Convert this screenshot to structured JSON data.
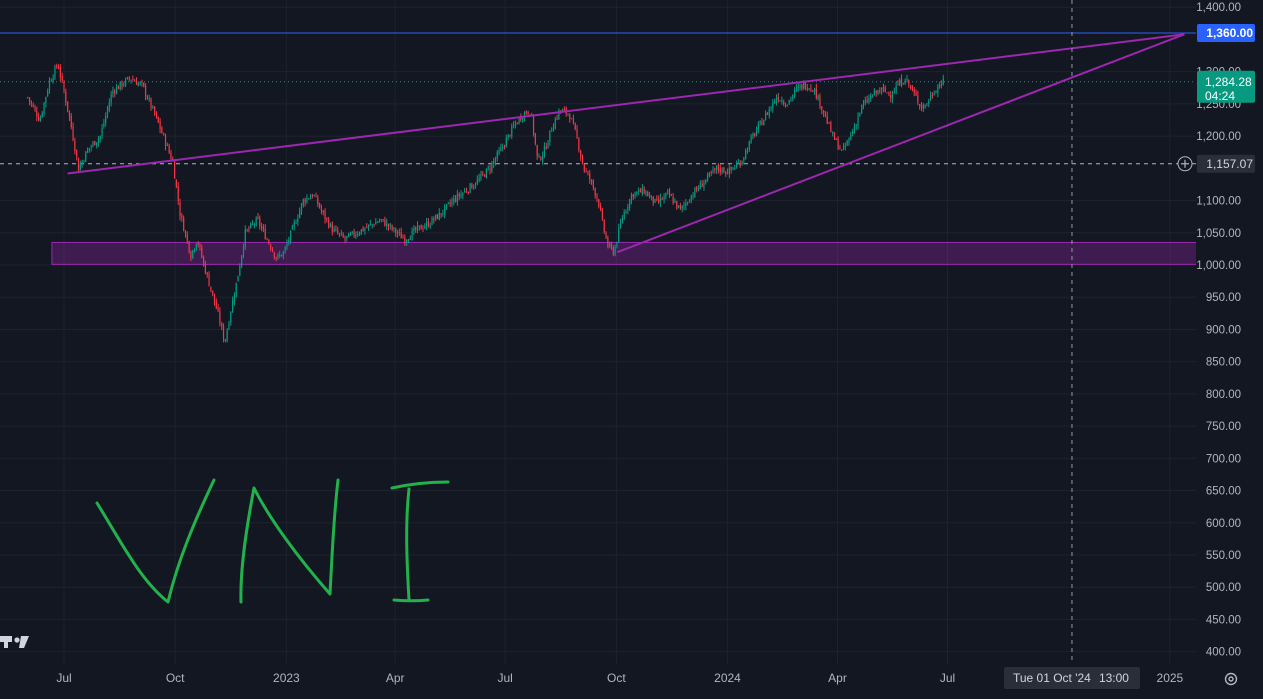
{
  "chart_data": {
    "type": "candlestick",
    "symbol_note": "VNI",
    "y_ticks": [
      "1,400.00",
      "1,300.00",
      "1,250.00",
      "1,200.00",
      "1,100.00",
      "1,050.00",
      "1,000.00",
      "950.00",
      "900.00",
      "850.00",
      "800.00",
      "750.00",
      "700.00",
      "650.00",
      "600.00",
      "550.00",
      "500.00",
      "450.00",
      "400.00"
    ],
    "y_tick_values": [
      1400,
      1300,
      1250,
      1200,
      1100,
      1050,
      1000,
      950,
      900,
      850,
      800,
      750,
      700,
      650,
      600,
      550,
      500,
      450,
      400
    ],
    "x_labels": [
      {
        "label": "Jul",
        "t": 0
      },
      {
        "label": "Oct",
        "t": 92
      },
      {
        "label": "2023",
        "t": 184
      },
      {
        "label": "Apr",
        "t": 274
      },
      {
        "label": "Jul",
        "t": 365
      },
      {
        "label": "Oct",
        "t": 457
      },
      {
        "label": "2024",
        "t": 549
      },
      {
        "label": "Apr",
        "t": 640
      },
      {
        "label": "Jul",
        "t": 731
      },
      {
        "label": "2025",
        "t": 915
      }
    ],
    "price_path": [
      [
        -30,
        1260
      ],
      [
        -20,
        1225
      ],
      [
        -12,
        1285
      ],
      [
        -5,
        1312
      ],
      [
        5,
        1225
      ],
      [
        12,
        1150
      ],
      [
        20,
        1180
      ],
      [
        30,
        1200
      ],
      [
        40,
        1270
      ],
      [
        55,
        1290
      ],
      [
        65,
        1278
      ],
      [
        78,
        1220
      ],
      [
        90,
        1160
      ],
      [
        96,
        1080
      ],
      [
        105,
        1015
      ],
      [
        110,
        1040
      ],
      [
        118,
        985
      ],
      [
        128,
        920
      ],
      [
        133,
        880
      ],
      [
        138,
        930
      ],
      [
        143,
        975
      ],
      [
        150,
        1050
      ],
      [
        160,
        1070
      ],
      [
        168,
        1040
      ],
      [
        176,
        1010
      ],
      [
        182,
        1020
      ],
      [
        190,
        1060
      ],
      [
        198,
        1100
      ],
      [
        206,
        1110
      ],
      [
        214,
        1080
      ],
      [
        222,
        1055
      ],
      [
        232,
        1040
      ],
      [
        242,
        1050
      ],
      [
        252,
        1060
      ],
      [
        262,
        1070
      ],
      [
        272,
        1055
      ],
      [
        282,
        1040
      ],
      [
        292,
        1055
      ],
      [
        302,
        1065
      ],
      [
        312,
        1080
      ],
      [
        322,
        1100
      ],
      [
        332,
        1115
      ],
      [
        342,
        1130
      ],
      [
        352,
        1150
      ],
      [
        362,
        1180
      ],
      [
        372,
        1215
      ],
      [
        380,
        1235
      ],
      [
        386,
        1240
      ],
      [
        392,
        1160
      ],
      [
        398,
        1180
      ],
      [
        404,
        1215
      ],
      [
        410,
        1240
      ],
      [
        418,
        1235
      ],
      [
        424,
        1200
      ],
      [
        430,
        1150
      ],
      [
        436,
        1130
      ],
      [
        442,
        1100
      ],
      [
        446,
        1060
      ],
      [
        450,
        1030
      ],
      [
        455,
        1020
      ],
      [
        462,
        1075
      ],
      [
        470,
        1110
      ],
      [
        480,
        1115
      ],
      [
        490,
        1095
      ],
      [
        500,
        1110
      ],
      [
        510,
        1085
      ],
      [
        520,
        1110
      ],
      [
        530,
        1130
      ],
      [
        540,
        1150
      ],
      [
        550,
        1145
      ],
      [
        560,
        1160
      ],
      [
        570,
        1200
      ],
      [
        580,
        1230
      ],
      [
        590,
        1262
      ],
      [
        598,
        1250
      ],
      [
        605,
        1270
      ],
      [
        612,
        1280
      ],
      [
        620,
        1275
      ],
      [
        628,
        1240
      ],
      [
        636,
        1200
      ],
      [
        644,
        1175
      ],
      [
        652,
        1205
      ],
      [
        660,
        1245
      ],
      [
        668,
        1262
      ],
      [
        676,
        1272
      ],
      [
        684,
        1265
      ],
      [
        690,
        1280
      ],
      [
        696,
        1290
      ],
      [
        702,
        1270
      ],
      [
        708,
        1250
      ],
      [
        712,
        1245
      ],
      [
        718,
        1265
      ],
      [
        724,
        1280
      ],
      [
        728,
        1284.28
      ]
    ],
    "horizontal_lines": [
      {
        "price": 1360,
        "label": "1,360.00",
        "color": "#2962ff"
      },
      {
        "price": 1157.07,
        "label": "1,157.07",
        "color": "#b2b5be",
        "style": "dashed"
      }
    ],
    "last_price": {
      "value": 1284.28,
      "label": "1,284.28",
      "countdown": "04:24",
      "color": "#089981"
    },
    "trendlines": [
      {
        "from": [
          3,
          1142
        ],
        "to": [
          927,
          1358
        ],
        "color": "#9c27b0"
      },
      {
        "from": [
          458,
          1020
        ],
        "to": [
          927,
          1358
        ],
        "color": "#9c27b0"
      }
    ],
    "zone": {
      "t_start": -10,
      "t_end": 1005,
      "price_low": 1001,
      "price_high": 1035,
      "color": "#9c27b0"
    },
    "crosshair": {
      "t": 834,
      "date_label": "Tue 01 Oct '24",
      "time_label": "13:00"
    },
    "up_color": "#089981",
    "down_color": "#f23645",
    "handwriting_color": "#22b24c"
  }
}
